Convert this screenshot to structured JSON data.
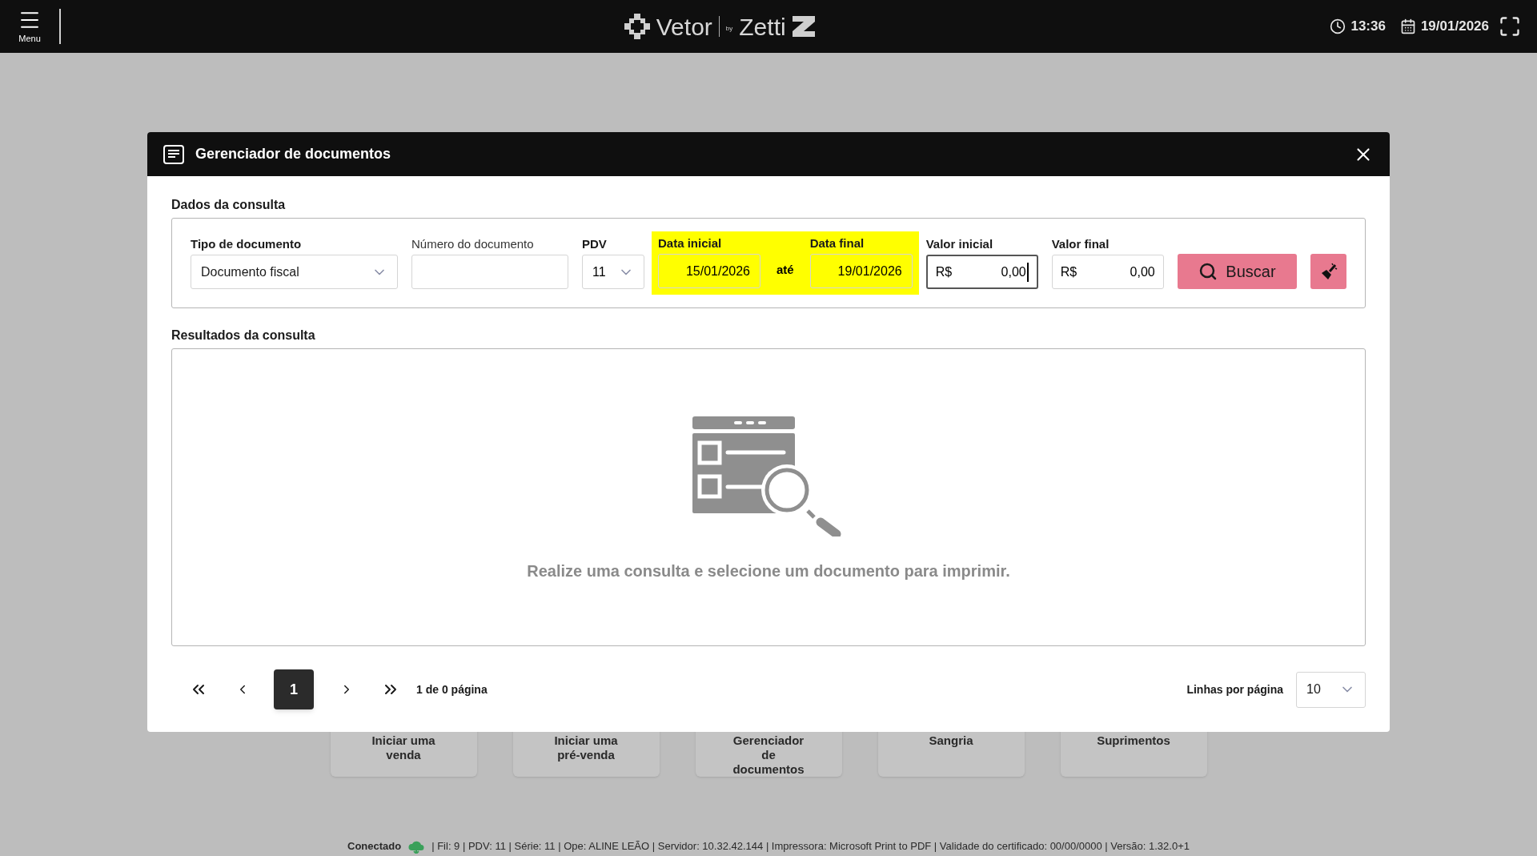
{
  "topbar": {
    "menu_label": "Menu",
    "brand": "Vetor",
    "brand_by": "by",
    "brand_partner": "Zetti",
    "time": "13:36",
    "date": "19/01/2026"
  },
  "dialog": {
    "title": "Gerenciador de documentos",
    "query": {
      "title": "Dados da consulta",
      "document_type": {
        "label": "Tipo de documento",
        "value": "Documento fiscal"
      },
      "document_number": {
        "label": "Número do documento"
      },
      "pdv": {
        "label": "PDV",
        "value": "11"
      },
      "date_range": {
        "highlighted": true,
        "start": {
          "label": "Data inicial",
          "value": "15/01/2026"
        },
        "separator": "até",
        "end": {
          "label": "Data final",
          "value": "19/01/2026"
        }
      },
      "amounts": [
        {
          "label": "Valor inicial",
          "prefix": "R$",
          "value": "0,00",
          "focused": true
        },
        {
          "label": "Valor final",
          "prefix": "R$",
          "value": "0,00",
          "focused": false
        }
      ],
      "search_button": "Buscar"
    },
    "results": {
      "title": "Resultados da consulta",
      "empty_message": "Realize uma consulta e selecione um documento para imprimir."
    },
    "pagination": {
      "pages": [
        {
          "label": "1",
          "selected": true
        }
      ],
      "summary": "1 de 0 página",
      "rows_label": "Linhas por página",
      "rows_value": "10"
    }
  },
  "shortcuts": [
    {
      "label": "Iniciar uma venda"
    },
    {
      "label": "Iniciar uma pré-venda"
    },
    {
      "label": "Gerenciador de documentos"
    },
    {
      "label": "Sangria"
    },
    {
      "label": "Suprimentos"
    }
  ],
  "status_bar": {
    "connection": "Conectado",
    "details": "| Fil: 9 | PDV: 11 | Série: 11 | Ope: ALINE LEÃO | Servidor: 10.32.42.144 | Impressora: Microsoft Print to PDF | Validade do certificado: 00/00/0000 | Versão: 1.32.0+1"
  }
}
